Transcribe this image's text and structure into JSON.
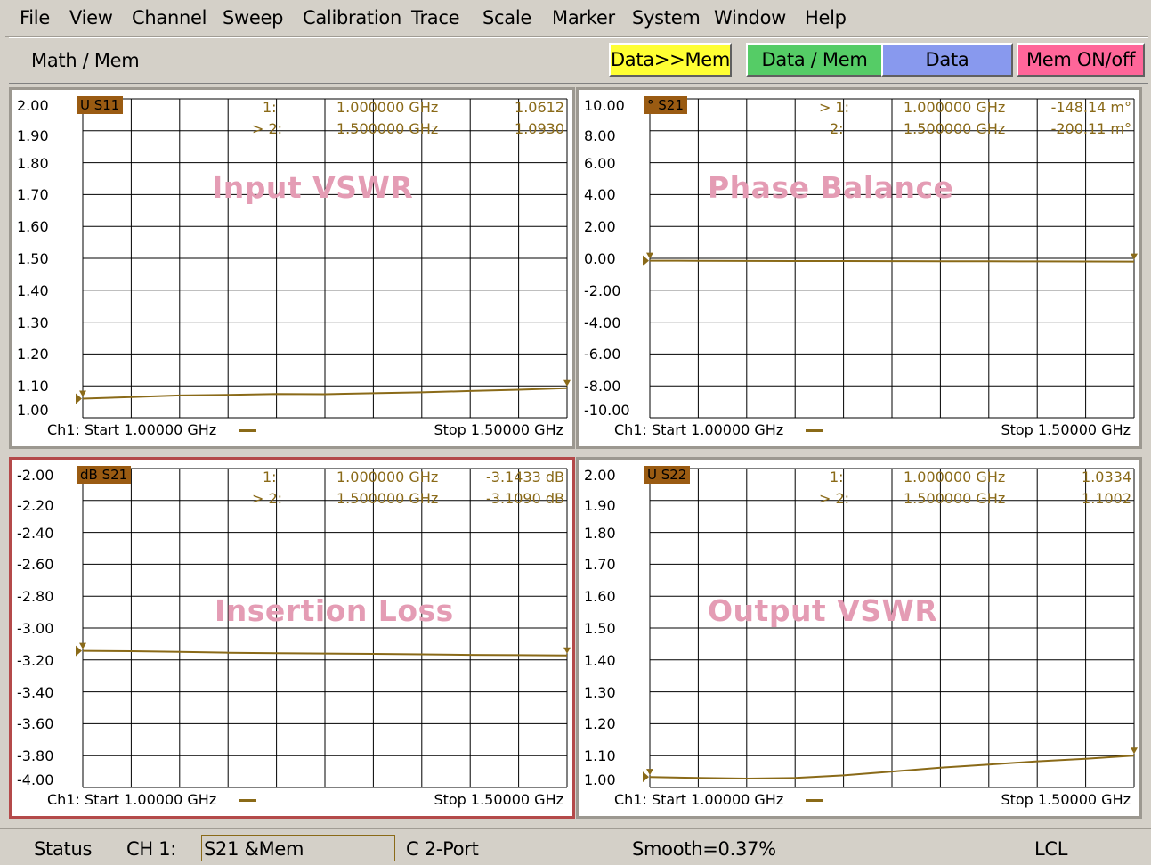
{
  "menu": [
    "File",
    "View",
    "Channel",
    "Sweep",
    "Calibration",
    "Trace",
    "Scale",
    "Marker",
    "System",
    "Window",
    "Help"
  ],
  "softkeys": {
    "title": "Math / Mem",
    "buttons": [
      {
        "label": "Data>>Mem",
        "color": "#ffff33"
      },
      {
        "label": "Data / Mem",
        "color": "#55cc66"
      },
      {
        "label": "Data",
        "color": "#8899ee"
      },
      {
        "label": "Mem ON/off",
        "color": "#ff6699"
      }
    ]
  },
  "panes": [
    {
      "title": "Input VSWR",
      "trace_label": "U S11",
      "y_ticks": [
        "2.00",
        "1.90",
        "1.80",
        "1.70",
        "1.60",
        "1.50",
        "1.40",
        "1.30",
        "1.20",
        "1.10",
        "1.00"
      ],
      "markers": [
        {
          "id": "1:",
          "freq": "1.000000 GHz",
          "value": "1.0612"
        },
        {
          "id": "> 2:",
          "freq": "1.500000 GHz",
          "value": "1.0930"
        }
      ],
      "start": "Ch1: Start  1.00000 GHz",
      "stop": "Stop  1.50000 GHz",
      "active": false,
      "chart_data": {
        "type": "line",
        "x": [
          1.0,
          1.05,
          1.1,
          1.15,
          1.2,
          1.25,
          1.3,
          1.35,
          1.4,
          1.45,
          1.5
        ],
        "values": [
          1.06,
          1.065,
          1.07,
          1.072,
          1.075,
          1.074,
          1.077,
          1.08,
          1.084,
          1.088,
          1.093
        ],
        "ylim": [
          1.0,
          2.0
        ],
        "xlim": [
          1.0,
          1.5
        ],
        "y_ticks": [
          2.0,
          1.9,
          1.8,
          1.7,
          1.6,
          1.5,
          1.4,
          1.3,
          1.2,
          1.1,
          1.0
        ]
      }
    },
    {
      "title": "Phase Balance",
      "trace_label": "° S21",
      "y_ticks": [
        "10.00",
        "8.00",
        "6.00",
        "4.00",
        "2.00",
        "0.00",
        "-2.00",
        "-4.00",
        "-6.00",
        "-8.00",
        "-10.00"
      ],
      "markers": [
        {
          "id": "> 1:",
          "freq": "1.000000 GHz",
          "value": "-148.14 m°"
        },
        {
          "id": "2:",
          "freq": "1.500000 GHz",
          "value": "-200.11 m°"
        }
      ],
      "start": "Ch1: Start  1.00000 GHz",
      "stop": "Stop  1.50000 GHz",
      "active": false,
      "chart_data": {
        "type": "line",
        "x": [
          1.0,
          1.05,
          1.1,
          1.15,
          1.2,
          1.25,
          1.3,
          1.35,
          1.4,
          1.45,
          1.5
        ],
        "values": [
          -0.148,
          -0.15,
          -0.16,
          -0.165,
          -0.17,
          -0.175,
          -0.18,
          -0.185,
          -0.19,
          -0.195,
          -0.2
        ],
        "ylim": [
          -10.0,
          10.0
        ],
        "xlim": [
          1.0,
          1.5
        ],
        "y_ticks": [
          10.0,
          8.0,
          6.0,
          4.0,
          2.0,
          0.0,
          -2.0,
          -4.0,
          -6.0,
          -8.0,
          -10.0
        ]
      }
    },
    {
      "title": "Insertion Loss",
      "trace_label": "dB S21",
      "y_ticks": [
        "-2.00",
        "-2.20",
        "-2.40",
        "-2.60",
        "-2.80",
        "-3.00",
        "-3.20",
        "-3.40",
        "-3.60",
        "-3.80",
        "-4.00"
      ],
      "markers": [
        {
          "id": "1:",
          "freq": "1.000000 GHz",
          "value": "-3.1433 dB"
        },
        {
          "id": "> 2:",
          "freq": "1.500000 GHz",
          "value": "-3.1090 dB"
        }
      ],
      "start": "Ch1: Start  1.00000 GHz",
      "stop": "Stop  1.50000 GHz",
      "active": true,
      "chart_data": {
        "type": "line",
        "x": [
          1.0,
          1.05,
          1.1,
          1.15,
          1.2,
          1.25,
          1.3,
          1.35,
          1.4,
          1.45,
          1.5
        ],
        "values": [
          -3.143,
          -3.145,
          -3.15,
          -3.155,
          -3.158,
          -3.16,
          -3.162,
          -3.165,
          -3.168,
          -3.17,
          -3.172
        ],
        "ylim": [
          -4.0,
          -2.0
        ],
        "xlim": [
          1.0,
          1.5
        ],
        "y_ticks": [
          -2.0,
          -2.2,
          -2.4,
          -2.6,
          -2.8,
          -3.0,
          -3.2,
          -3.4,
          -3.6,
          -3.8,
          -4.0
        ]
      }
    },
    {
      "title": "Output VSWR",
      "trace_label": "U S22",
      "y_ticks": [
        "2.00",
        "1.90",
        "1.80",
        "1.70",
        "1.60",
        "1.50",
        "1.40",
        "1.30",
        "1.20",
        "1.10",
        "1.00"
      ],
      "markers": [
        {
          "id": "1:",
          "freq": "1.000000 GHz",
          "value": "1.0334"
        },
        {
          "id": "> 2:",
          "freq": "1.500000 GHz",
          "value": "1.1002"
        }
      ],
      "start": "Ch1: Start  1.00000 GHz",
      "stop": "Stop  1.50000 GHz",
      "active": false,
      "chart_data": {
        "type": "line",
        "x": [
          1.0,
          1.05,
          1.1,
          1.15,
          1.2,
          1.25,
          1.3,
          1.35,
          1.4,
          1.45,
          1.5
        ],
        "values": [
          1.033,
          1.03,
          1.028,
          1.03,
          1.038,
          1.05,
          1.062,
          1.072,
          1.082,
          1.09,
          1.1
        ],
        "ylim": [
          1.0,
          2.0
        ],
        "xlim": [
          1.0,
          1.5
        ],
        "y_ticks": [
          2.0,
          1.9,
          1.8,
          1.7,
          1.6,
          1.5,
          1.4,
          1.3,
          1.2,
          1.1,
          1.0
        ]
      }
    }
  ],
  "status": {
    "label": "Status",
    "channel": "CH 1:",
    "field": "S21 &Mem",
    "cal": "C  2-Port",
    "smooth": "Smooth=0.37%",
    "remote": "LCL"
  },
  "colors": {
    "trace": "#8a6a18",
    "title": "#e49cb4",
    "grid": "#000000",
    "active_border": "#b44a4a"
  }
}
